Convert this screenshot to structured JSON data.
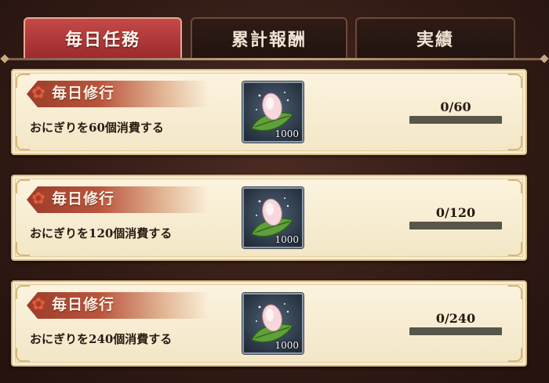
{
  "tabs": [
    {
      "label": "毎日任務",
      "active": true
    },
    {
      "label": "累計報酬",
      "active": false
    },
    {
      "label": "実績",
      "active": false
    }
  ],
  "missions": [
    {
      "category": "毎日修行",
      "description": "おにぎりを60個消費する",
      "item_icon": "onigiri-leaf-icon",
      "reward_count": "1000",
      "progress_text": "0/60",
      "current": 0,
      "target": 60
    },
    {
      "category": "毎日修行",
      "description": "おにぎりを120個消費する",
      "item_icon": "onigiri-leaf-icon",
      "reward_count": "1000",
      "progress_text": "0/120",
      "current": 0,
      "target": 120
    },
    {
      "category": "毎日修行",
      "description": "おにぎりを240個消費する",
      "item_icon": "onigiri-leaf-icon",
      "reward_count": "1000",
      "progress_text": "0/240",
      "current": 0,
      "target": 240
    }
  ],
  "colors": {
    "active_tab": "#b5393b",
    "card_bg": "#f8eed6",
    "ribbon": "#a8432e",
    "progress_track": "#58554b"
  }
}
